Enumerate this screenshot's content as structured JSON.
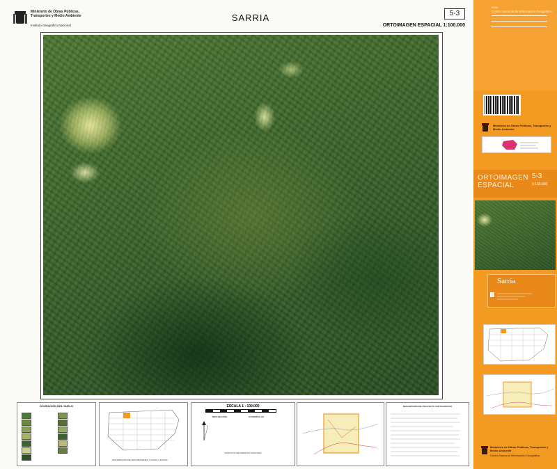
{
  "header": {
    "ministry": "Ministerio de Obras Públicas, Transportes y Medio Ambiente",
    "institute": "Instituto Geográfico Nacional",
    "title": "SARRIA",
    "sheet_number": "5-3",
    "subtitle": "ORTOIMAGEN ESPACIAL 1:100.000"
  },
  "map": {
    "description_alt": "satellite-orthoimage"
  },
  "legend": {
    "title": "OCUPACIÓN DEL SUELO"
  },
  "scale_box": {
    "title": "ESCALA 1 : 100.000",
    "declination_label": "DECLINACIÓN",
    "convergence_label": "CUADRÍCULAS"
  },
  "location_map": {
    "caption": "DISTRIBUCIÓN DE ORTOIMÁGENES Y HOJAS 1:100.000"
  },
  "project_box": {
    "title": "DESCRIPCIÓN DEL PROYECTO CARTOGRÁFICO",
    "institute": "INSTITUTO GEOGRÁFICO NACIONAL"
  },
  "side_panel": {
    "edition": "Edita",
    "center": "Centro Nacional de Información Geográfica",
    "ministry": "Ministerio de Obras Públicas, Transportes y Medio Ambiente",
    "product": "ORTOIMAGEN ESPACIAL",
    "sheet_number": "5-3",
    "scale": "1:100.000",
    "sheet_name": "Sarria",
    "footer_ministry": "Ministerio de Obras Públicas, Transportes y Medio Ambiente",
    "footer_center": "Centro Nacional Información Geográfica"
  },
  "colors": {
    "panel_orange": "#f39a22",
    "vegetation_green": "#3f6a2c"
  }
}
